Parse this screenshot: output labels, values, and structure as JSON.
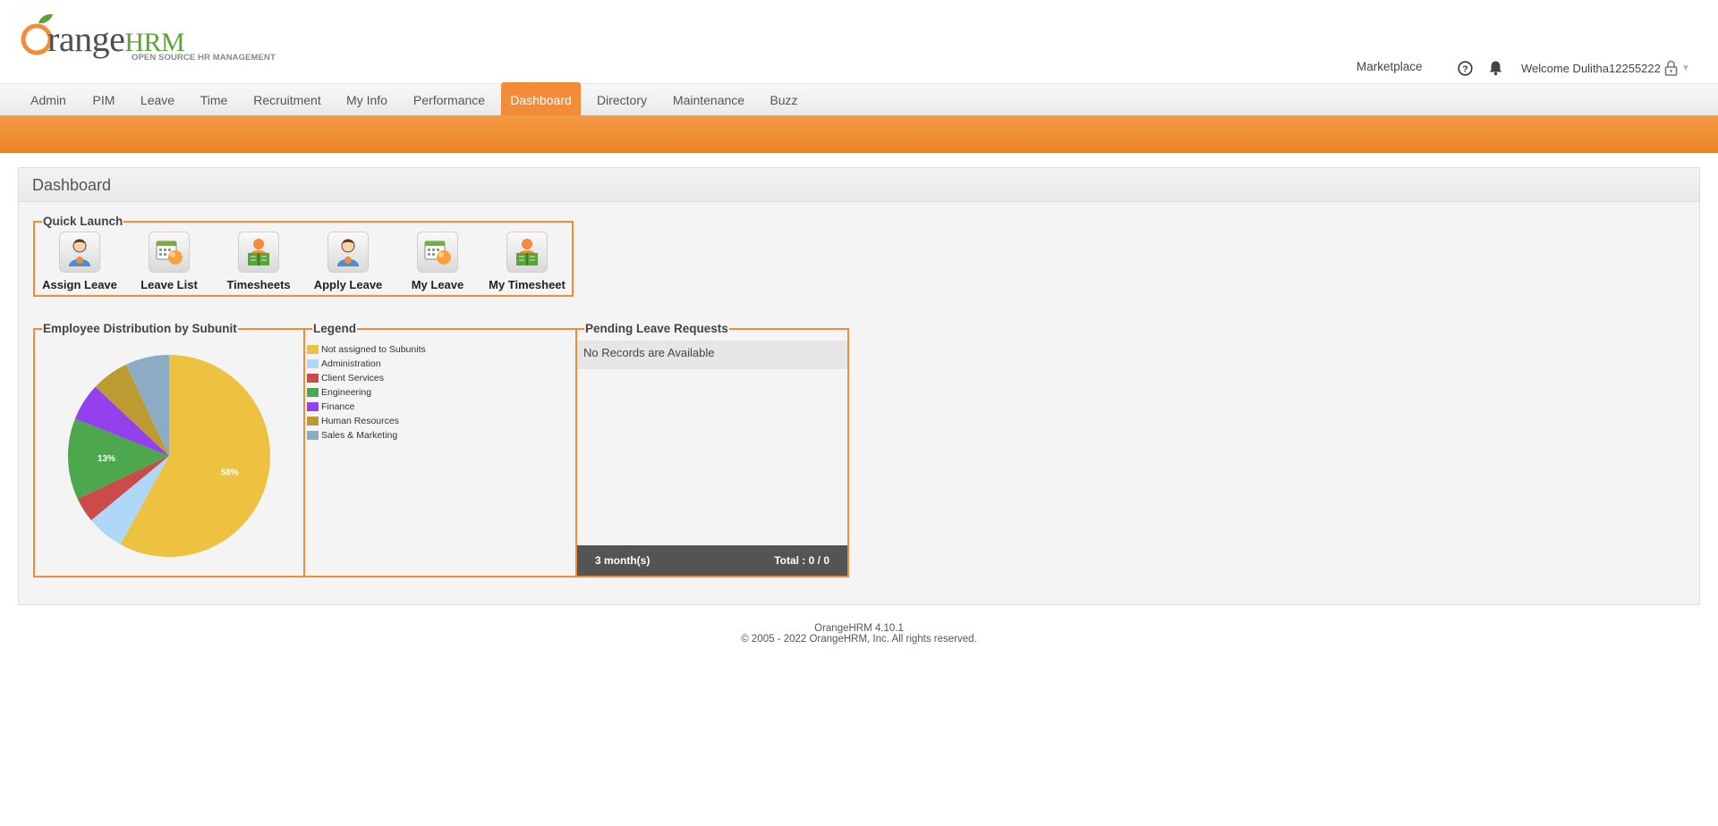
{
  "brand": {
    "name_part1": "range",
    "name_part2": "HRM",
    "tagline": "OPEN SOURCE HR MANAGEMENT",
    "orange": "#f28c38",
    "green": "#5aa33a"
  },
  "topbar": {
    "marketplace": "Marketplace",
    "welcome": "Welcome Dulitha12255222",
    "caret": "▼"
  },
  "menu": {
    "items": [
      {
        "label": "Admin"
      },
      {
        "label": "PIM"
      },
      {
        "label": "Leave"
      },
      {
        "label": "Time"
      },
      {
        "label": "Recruitment"
      },
      {
        "label": "My Info"
      },
      {
        "label": "Performance"
      },
      {
        "label": "Dashboard",
        "active": true
      },
      {
        "label": "Directory"
      },
      {
        "label": "Maintenance"
      },
      {
        "label": "Buzz"
      }
    ]
  },
  "dashboard": {
    "title": "Dashboard",
    "quick_launch": {
      "title": "Quick Launch",
      "items": [
        {
          "label": "Assign Leave",
          "icon": "person-icon"
        },
        {
          "label": "Leave List",
          "icon": "calendar-icon"
        },
        {
          "label": "Timesheets",
          "icon": "timesheet-icon"
        },
        {
          "label": "Apply Leave",
          "icon": "person-icon"
        },
        {
          "label": "My Leave",
          "icon": "calendar-icon"
        },
        {
          "label": "My Timesheet",
          "icon": "timesheet-icon"
        }
      ]
    },
    "distribution_title": "Employee Distribution by Subunit",
    "legend_title": "Legend",
    "pending_title": "Pending Leave Requests",
    "no_records": "No Records are Available",
    "period": "3 month(s)",
    "total": "Total : 0 / 0"
  },
  "chart_data": {
    "type": "pie",
    "title": "Employee Distribution by Subunit",
    "categories": [
      "Not assigned to Subunits",
      "Administration",
      "Client Services",
      "Engineering",
      "Finance",
      "Human Resources",
      "Sales & Marketing"
    ],
    "values": [
      58,
      6,
      4,
      13,
      6,
      6,
      7
    ],
    "colors": [
      "#edc240",
      "#afd8f8",
      "#cb4b4b",
      "#4da74d",
      "#9440ed",
      "#bd9b33",
      "#8cacc6"
    ],
    "data_labels": [
      "58%",
      "",
      "",
      "13%",
      "",
      "",
      ""
    ],
    "legend": "separate panel"
  },
  "footer": {
    "version": "OrangeHRM 4.10.1",
    "copyright": "© 2005 - 2022 OrangeHRM, Inc. All rights reserved."
  }
}
